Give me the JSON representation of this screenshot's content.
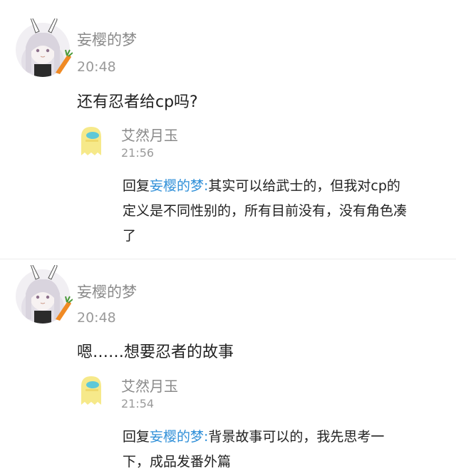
{
  "comments": [
    {
      "author": "妄樱的梦",
      "time": "20:48",
      "text": "还有忍者给cp吗?",
      "reply": {
        "author": "艾然月玉",
        "time": "21:56",
        "prefix": "回复",
        "mention": "妄樱的梦:",
        "body_line1": "其实可以给武士的，但我对cp的",
        "body_line2": "定义是不同性别的，所有目前没有，没有角色凑",
        "body_line3": "了"
      }
    },
    {
      "author": "妄樱的梦",
      "time": "20:48",
      "text": "嗯……想要忍者的故事",
      "reply": {
        "author": "艾然月玉",
        "time": "21:54",
        "prefix": "回复",
        "mention": "妄樱的梦:",
        "body_line1": "背景故事可以的，我先思考一",
        "body_line2": "下，成品发番外篇"
      }
    }
  ],
  "colors": {
    "mention": "#2f8fd8",
    "name": "#8a8a8a",
    "time": "#9a9a9a",
    "text": "#1f1f1f",
    "divider": "#ececec",
    "carrot": "#f08a24",
    "reply_avatar_yellow": "#f6e98a",
    "reply_avatar_cyan": "#5ec8d8"
  },
  "icons": {
    "user_avatar": "bunny-girl-avatar-icon",
    "reply_avatar": "yellow-ghost-avatar-icon"
  }
}
